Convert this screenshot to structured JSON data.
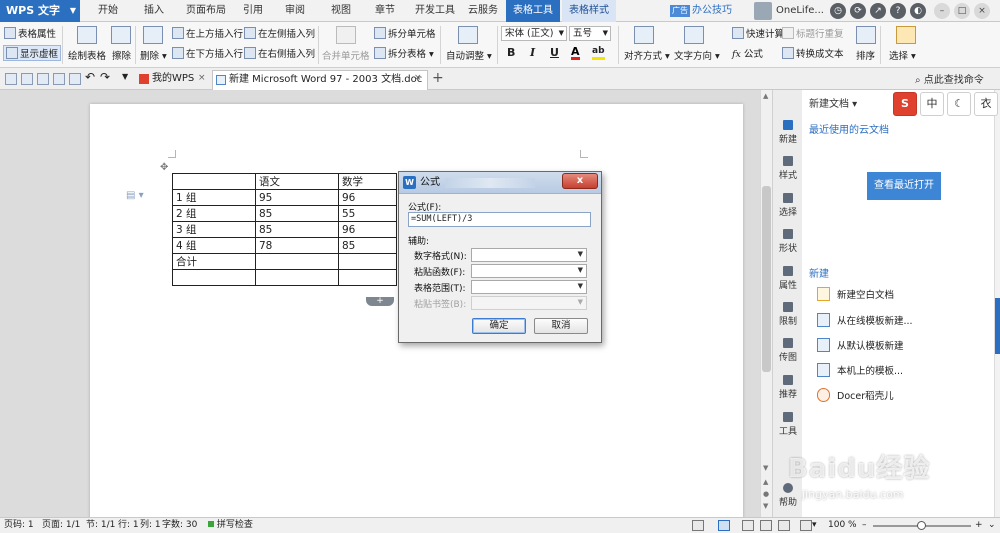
{
  "app": {
    "title": "WPS 文字"
  },
  "menu": {
    "tabs": [
      "开始",
      "插入",
      "页面布局",
      "引用",
      "审阅",
      "视图",
      "章节",
      "开发工具",
      "云服务",
      "表格工具",
      "表格样式"
    ],
    "active": "表格工具",
    "ad": "广告",
    "tips": "办公技巧"
  },
  "user": {
    "name": "OneLife..."
  },
  "ribbon": {
    "table_props": "表格属性",
    "show_gridlines": "显示虚框",
    "draw_table": "绘制表格",
    "erase": "擦除",
    "delete": "删除",
    "insert_above": "在上方插入行",
    "insert_below": "在下方插入行",
    "insert_left": "在左侧插入列",
    "insert_right": "在右侧插入列",
    "merge_cells": "合并单元格",
    "split_cells": "拆分单元格",
    "split_table": "拆分表格",
    "auto_fit": "自动调整",
    "font_name": "宋体 (正文)",
    "font_size": "五号",
    "bold": "B",
    "italic": "I",
    "underline": "U",
    "font_color": "A",
    "highlight": "ab",
    "align": "对齐方式",
    "text_direction": "文字方向",
    "formula": "公式",
    "quick_calc": "快速计算",
    "repeat_header": "标题行重复",
    "to_text": "转换成文本",
    "sort": "排序",
    "select": "选择"
  },
  "tabs": {
    "home": "我的WPS",
    "doc": "新建 Microsoft Word 97 - 2003 文档.doc *",
    "find": "点此查找命令"
  },
  "table": {
    "rows": [
      [
        "",
        "语文",
        "数学"
      ],
      [
        "1 组",
        "95",
        "96"
      ],
      [
        "2 组",
        "85",
        "55"
      ],
      [
        "3 组",
        "85",
        "96"
      ],
      [
        "4 组",
        "78",
        "85"
      ],
      [
        "合计",
        "",
        ""
      ],
      [
        "",
        "",
        ""
      ]
    ],
    "add_row": "+"
  },
  "dialog": {
    "title": "公式",
    "close": "x",
    "formula_label": "公式(F):",
    "formula_value": "=SUM(LEFT)/3",
    "aux_label": "辅助:",
    "number_format": "数字格式(N):",
    "paste_function": "粘贴函数(F):",
    "table_range": "表格范围(T):",
    "paste_bookmark": "粘贴书签(B):",
    "ok": "确定",
    "cancel": "取消"
  },
  "rail": [
    {
      "label": "新建"
    },
    {
      "label": "样式"
    },
    {
      "label": "选择"
    },
    {
      "label": "形状"
    },
    {
      "label": "属性"
    },
    {
      "label": "限制"
    },
    {
      "label": "传图"
    },
    {
      "label": "推荐"
    },
    {
      "label": "工具"
    },
    {
      "label": "帮助"
    }
  ],
  "panel": {
    "new_doc": "新建文档",
    "recent_cloud": "最近使用的云文档",
    "view_recent": "查看最近打开",
    "new_heading": "新建",
    "items": [
      "新建空白文档",
      "从在线模板新建...",
      "从默认模板新建",
      "本机上的模板...",
      "Docer稻壳儿"
    ]
  },
  "ime": [
    "S",
    "中",
    "☾",
    "衣"
  ],
  "status": {
    "page_no": "页码: 1",
    "pages": "页面: 1/1",
    "section": "节: 1/1",
    "row": "行: 1",
    "col": "列: 1",
    "words": "字数: 30",
    "spell": "拼写检查",
    "zoom": "100 %"
  },
  "watermark": {
    "brand": "Baidu经验",
    "url": "jingyan.baidu.com"
  }
}
